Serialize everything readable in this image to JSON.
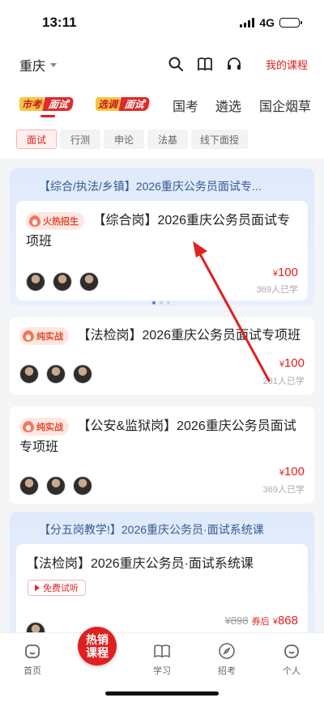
{
  "status": {
    "time": "13:11",
    "network": "4G"
  },
  "header": {
    "city": "重庆",
    "my_course": "我的课程"
  },
  "tabs": {
    "brand1": {
      "a": "市考",
      "b": "面试"
    },
    "brand2": {
      "a": "选调",
      "b": "面试"
    },
    "items": [
      "国考",
      "遴选",
      "国企烟草"
    ]
  },
  "chips": [
    "面试",
    "行测",
    "申论",
    "法基",
    "线下面授"
  ],
  "feature1": {
    "title": "【综合/执法/乡镇】2026重庆公务员面试专...",
    "badge": "火热招生",
    "course_title": "【综合岗】2026重庆公务员面试专项班",
    "price_symbol": "¥",
    "price": "100",
    "enrolled": "369人已学"
  },
  "card2": {
    "badge": "纯实战",
    "course_title": "【法检岗】2026重庆公务员面试专项班",
    "price_symbol": "¥",
    "price": "100",
    "enrolled": "281人已学"
  },
  "card3": {
    "badge": "纯实战",
    "course_title": "【公安&监狱岗】2026重庆公务员面试专项班",
    "price_symbol": "¥",
    "price": "100",
    "enrolled": "369人已学"
  },
  "feature2": {
    "title": "【分五岗教学!】2026重庆公务员·面试系统课",
    "course_title": "【法检岗】2026重庆公务员·面试系统课",
    "trial": "免费试听",
    "orig_price": "¥898",
    "after_label": "券后",
    "price_symbol": "¥",
    "price": "868"
  },
  "tabbar": {
    "home": "首页",
    "hot": "热销课程",
    "study": "学习",
    "exam": "招考",
    "me": "个人"
  },
  "colors": {
    "accent": "#e02020",
    "brand_yellow": "#f6c544",
    "feature_bg": "#dfeafb"
  }
}
